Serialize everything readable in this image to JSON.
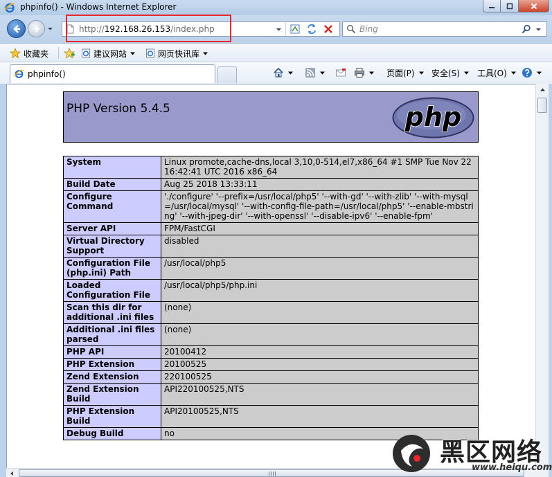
{
  "window": {
    "title": "phpinfo() - Windows Internet Explorer"
  },
  "address_bar": {
    "url_scheme": "http://",
    "url_host": "192.168.26.153",
    "url_path": "/index.php"
  },
  "search": {
    "placeholder": "Bing"
  },
  "favorites_bar": {
    "favorites_label": "收藏夹",
    "items": [
      {
        "label": "建议网站"
      },
      {
        "label": "网页快讯库"
      }
    ]
  },
  "tab": {
    "label": "phpinfo()"
  },
  "command_bar": {
    "page_label": "页面(P)",
    "safety_label": "安全(S)",
    "tools_label": "工具(O)"
  },
  "phpinfo": {
    "version_title": "PHP Version 5.4.5",
    "logo_text": "php",
    "rows": [
      {
        "key": "System",
        "value": "Linux promote,cache-dns,local 3,10,0-514,el7,x86_64 #1 SMP Tue Nov 22 16:42:41 UTC 2016 x86_64"
      },
      {
        "key": "Build Date",
        "value": "Aug 25 2018 13:33:11"
      },
      {
        "key": "Configure Command",
        "value": "'./configure' '--prefix=/usr/local/php5' '--with-gd' '--with-zlib' '--with-mysql=/usr/local/mysql' '--with-config-file-path=/usr/local/php5' '--enable-mbstring' '--with-jpeg-dir' '--with-openssl' '--disable-ipv6' '--enable-fpm'"
      },
      {
        "key": "Server API",
        "value": "FPM/FastCGI"
      },
      {
        "key": "Virtual Directory Support",
        "value": "disabled"
      },
      {
        "key": "Configuration File (php.ini) Path",
        "value": "/usr/local/php5"
      },
      {
        "key": "Loaded Configuration File",
        "value": "/usr/local/php5/php.ini"
      },
      {
        "key": "Scan this dir for additional .ini files",
        "value": "(none)"
      },
      {
        "key": "Additional .ini files parsed",
        "value": "(none)"
      },
      {
        "key": "PHP API",
        "value": "20100412"
      },
      {
        "key": "PHP Extension",
        "value": "20100525"
      },
      {
        "key": "Zend Extension",
        "value": "220100525"
      },
      {
        "key": "Zend Extension Build",
        "value": "API220100525,NTS"
      },
      {
        "key": "PHP Extension Build",
        "value": "API20100525,NTS"
      },
      {
        "key": "Debug Build",
        "value": "no"
      }
    ]
  },
  "watermark": {
    "title": "黑区网络",
    "url": "www.heiqu.com"
  },
  "colors": {
    "php_header_bg": "#9999cc",
    "key_cell_bg": "#ccccff",
    "value_cell_bg": "#cccccc",
    "highlight_red": "#e8262d"
  }
}
